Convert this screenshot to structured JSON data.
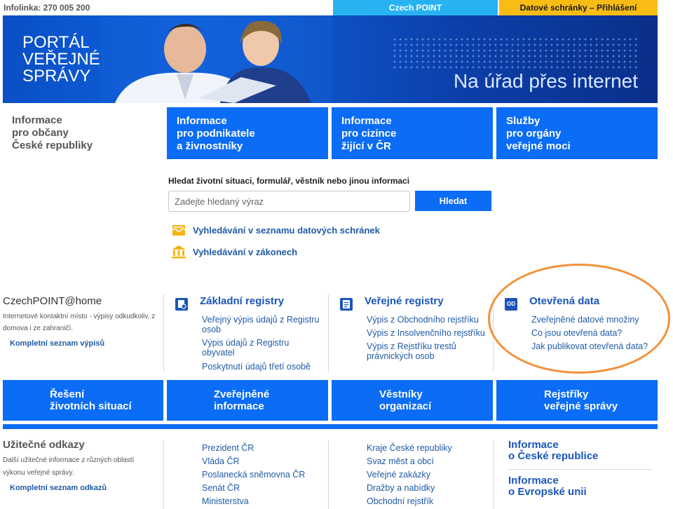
{
  "topbar": {
    "infolinka": "Infolinka: 270 005 200",
    "czechpoint": "Czech POINT",
    "datove_schranky": "Datové schránky – Přihlášení"
  },
  "banner": {
    "logo_lines": [
      "PORTÁL",
      "VEŘEJNÉ",
      "SPRÁVY"
    ],
    "slogan": "Na úřad přes internet"
  },
  "intro": {
    "lines": [
      "Informace",
      "pro občany",
      "České republiky"
    ]
  },
  "tiles": [
    {
      "lines": [
        "Informace",
        "pro podnikatele",
        "a živnostníky"
      ]
    },
    {
      "lines": [
        "Informace",
        "pro cizince",
        "žijící v ČR"
      ]
    },
    {
      "lines": [
        "Služby",
        "pro orgány",
        "veřejné moci"
      ]
    }
  ],
  "search": {
    "label": "Hledat životní situaci, formulář, věstník nebo jinou informaci",
    "placeholder": "Zadejte hledaný výraz",
    "button": "Hledat"
  },
  "quick_links": [
    {
      "label": "Vyhledávání v seznamu datových schránek",
      "icon": "mailbox-icon"
    },
    {
      "label": "Vyhledávání v zákonech",
      "icon": "institution-icon"
    }
  ],
  "czechpoint_home": {
    "title": "CzechPOINT@home",
    "desc": "Internetové kontaktní místo - výpisy odkudkoliv, z domova i ze zahraničí.",
    "link": "Kompletní seznam výpisů"
  },
  "columns": [
    {
      "title": "Základní registry",
      "icon": "registry-icon",
      "links": [
        "Veřejný výpis údajů z Registru osob",
        "Výpis údajů z Registru obyvatel",
        "Poskytnutí údajů třetí osobě"
      ]
    },
    {
      "title": "Veřejné registry",
      "icon": "document-icon",
      "links": [
        "Výpis z Obchodního rejstříku",
        "Výpis z Insolvenčního rejstříku",
        "Výpis z Rejstříku trestů právnických osob"
      ]
    },
    {
      "title": "Otevřená data",
      "icon": "od-icon",
      "icon_text": "OD",
      "links": [
        "Zveřejněné datové množiny",
        "Co jsou otevřená data?",
        "Jak publikovat otevřená data?"
      ]
    }
  ],
  "bottom_tiles": [
    {
      "lines": [
        "Řešení",
        "životních situací"
      ]
    },
    {
      "lines": [
        "Zveřejněné",
        "informace"
      ]
    },
    {
      "lines": [
        "Věstníky",
        "organizací"
      ]
    },
    {
      "lines": [
        "Rejstříky",
        "veřejné správy"
      ]
    }
  ],
  "useful": {
    "title": "Užitečné odkazy",
    "desc": "Další užitečné informace z různých oblastí výkonu veřejné správy.",
    "link": "Kompletní seznam odkazů",
    "col1": [
      "Prezident ČR",
      "Vláda ČR",
      "Poslanecká sněmovna ČR",
      "Senát ČR",
      "Ministerstva"
    ],
    "col2": [
      "Kraje České republiky",
      "Svaz měst a obcí",
      "Veřejné zakázky",
      "Dražby a nabídky",
      "Obchodní rejstřík"
    ],
    "info1": [
      "Informace",
      "o České republice"
    ],
    "info2": [
      "Informace",
      "o Evropské unii"
    ]
  },
  "colors": {
    "primary_blue": "#0b6cf5",
    "czechpoint_tab": "#27b3f2",
    "datove_tab": "#f8bc15",
    "highlight_ellipse": "#f3923b"
  }
}
